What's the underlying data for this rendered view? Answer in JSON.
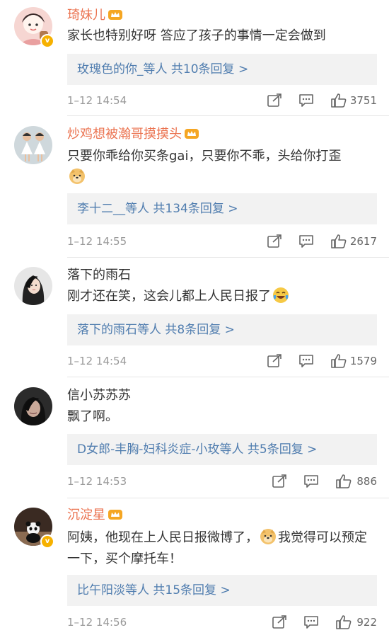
{
  "comments": [
    {
      "name": "琦妹儿",
      "name_color": "orange",
      "text_parts": [
        "家长也特别好呀 答应了孩子的事情一定会做到"
      ],
      "reply": "玫瑰色的你_等人  共10条回复 >",
      "time": "1–12 14:54",
      "likes": "3751",
      "verified": true,
      "crown": true
    },
    {
      "name": "炒鸡想被瀚哥摸摸头",
      "name_color": "orange",
      "text_parts": [
        "只要你乖给你买条gai，只要你不乖，头给你打歪"
      ],
      "emoji_after": "doge",
      "reply": "李十二__等人  共134条回复 >",
      "time": "1–12 14:55",
      "likes": "2617",
      "verified": false,
      "crown": true
    },
    {
      "name": "落下的雨石",
      "name_color": "gray",
      "text_parts": [
        "刚才还在笑，这会儿都上人民日报了"
      ],
      "emoji_inline": "laugh-cry",
      "reply": "落下的雨石等人  共8条回复 >",
      "time": "1–12 14:54",
      "likes": "1579",
      "verified": false,
      "crown": false
    },
    {
      "name": "信小苏苏苏",
      "name_color": "gray",
      "text_parts": [
        "飘了啊。"
      ],
      "reply": "D女郎-丰胸-妇科炎症-小玫等人  共5条回复 >",
      "time": "1–12 14:53",
      "likes": "886",
      "verified": false,
      "crown": false
    },
    {
      "name": "沉淀星",
      "name_color": "orange",
      "text_parts": [
        "阿姨，他现在上人民日报微博了，",
        "我觉得可以预定一下，买个摩托车！"
      ],
      "emoji_mid": "doge",
      "reply": "比午阳淡等人  共15条回复 >",
      "time": "1–12 14:56",
      "likes": "922",
      "verified": true,
      "crown": true
    }
  ],
  "icons": {
    "forward": "share-icon",
    "comment": "comment-icon",
    "like": "thumbs-up-icon"
  },
  "colors": {
    "name_orange": "#eb7350",
    "link_blue": "#507daf",
    "reply_bg": "#f2f2f2",
    "meta_gray": "#999999"
  }
}
